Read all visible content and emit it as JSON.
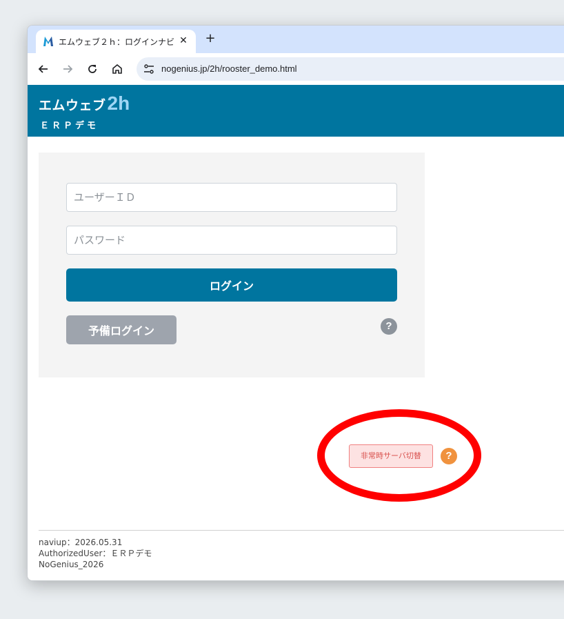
{
  "browser": {
    "tab_title": "エムウェブ２ｈ：ログインナビ",
    "tab_close": "✕",
    "new_tab": "+",
    "url": "nogenius.jp/2h/rooster_demo.html",
    "favicon_letter": "M"
  },
  "header": {
    "brand_main": "エムウェブ",
    "brand_2h": "2h",
    "brand_sub": "ＥＲＰデモ"
  },
  "login": {
    "userid_placeholder": "ユーザーＩＤ",
    "password_placeholder": "パスワード",
    "login_label": "ログイン",
    "backup_login_label": "予備ログイン",
    "help_label": "?"
  },
  "emergency": {
    "switch_label": "非常時サーバ切替",
    "help_label": "?"
  },
  "footer": {
    "line1": "naviup：2026.05.31",
    "line2": "AuthorizedUser：ＥＲＰデモ",
    "line3": "NoGenius_2026"
  },
  "colors": {
    "brand_blue": "#00759f",
    "annotation_red": "#ff0000",
    "help_orange": "#f0923e"
  },
  "icons": [
    "back-arrow-icon",
    "forward-arrow-icon",
    "reload-icon",
    "home-icon",
    "site-settings-icon",
    "close-icon",
    "plus-icon",
    "help-icon"
  ]
}
